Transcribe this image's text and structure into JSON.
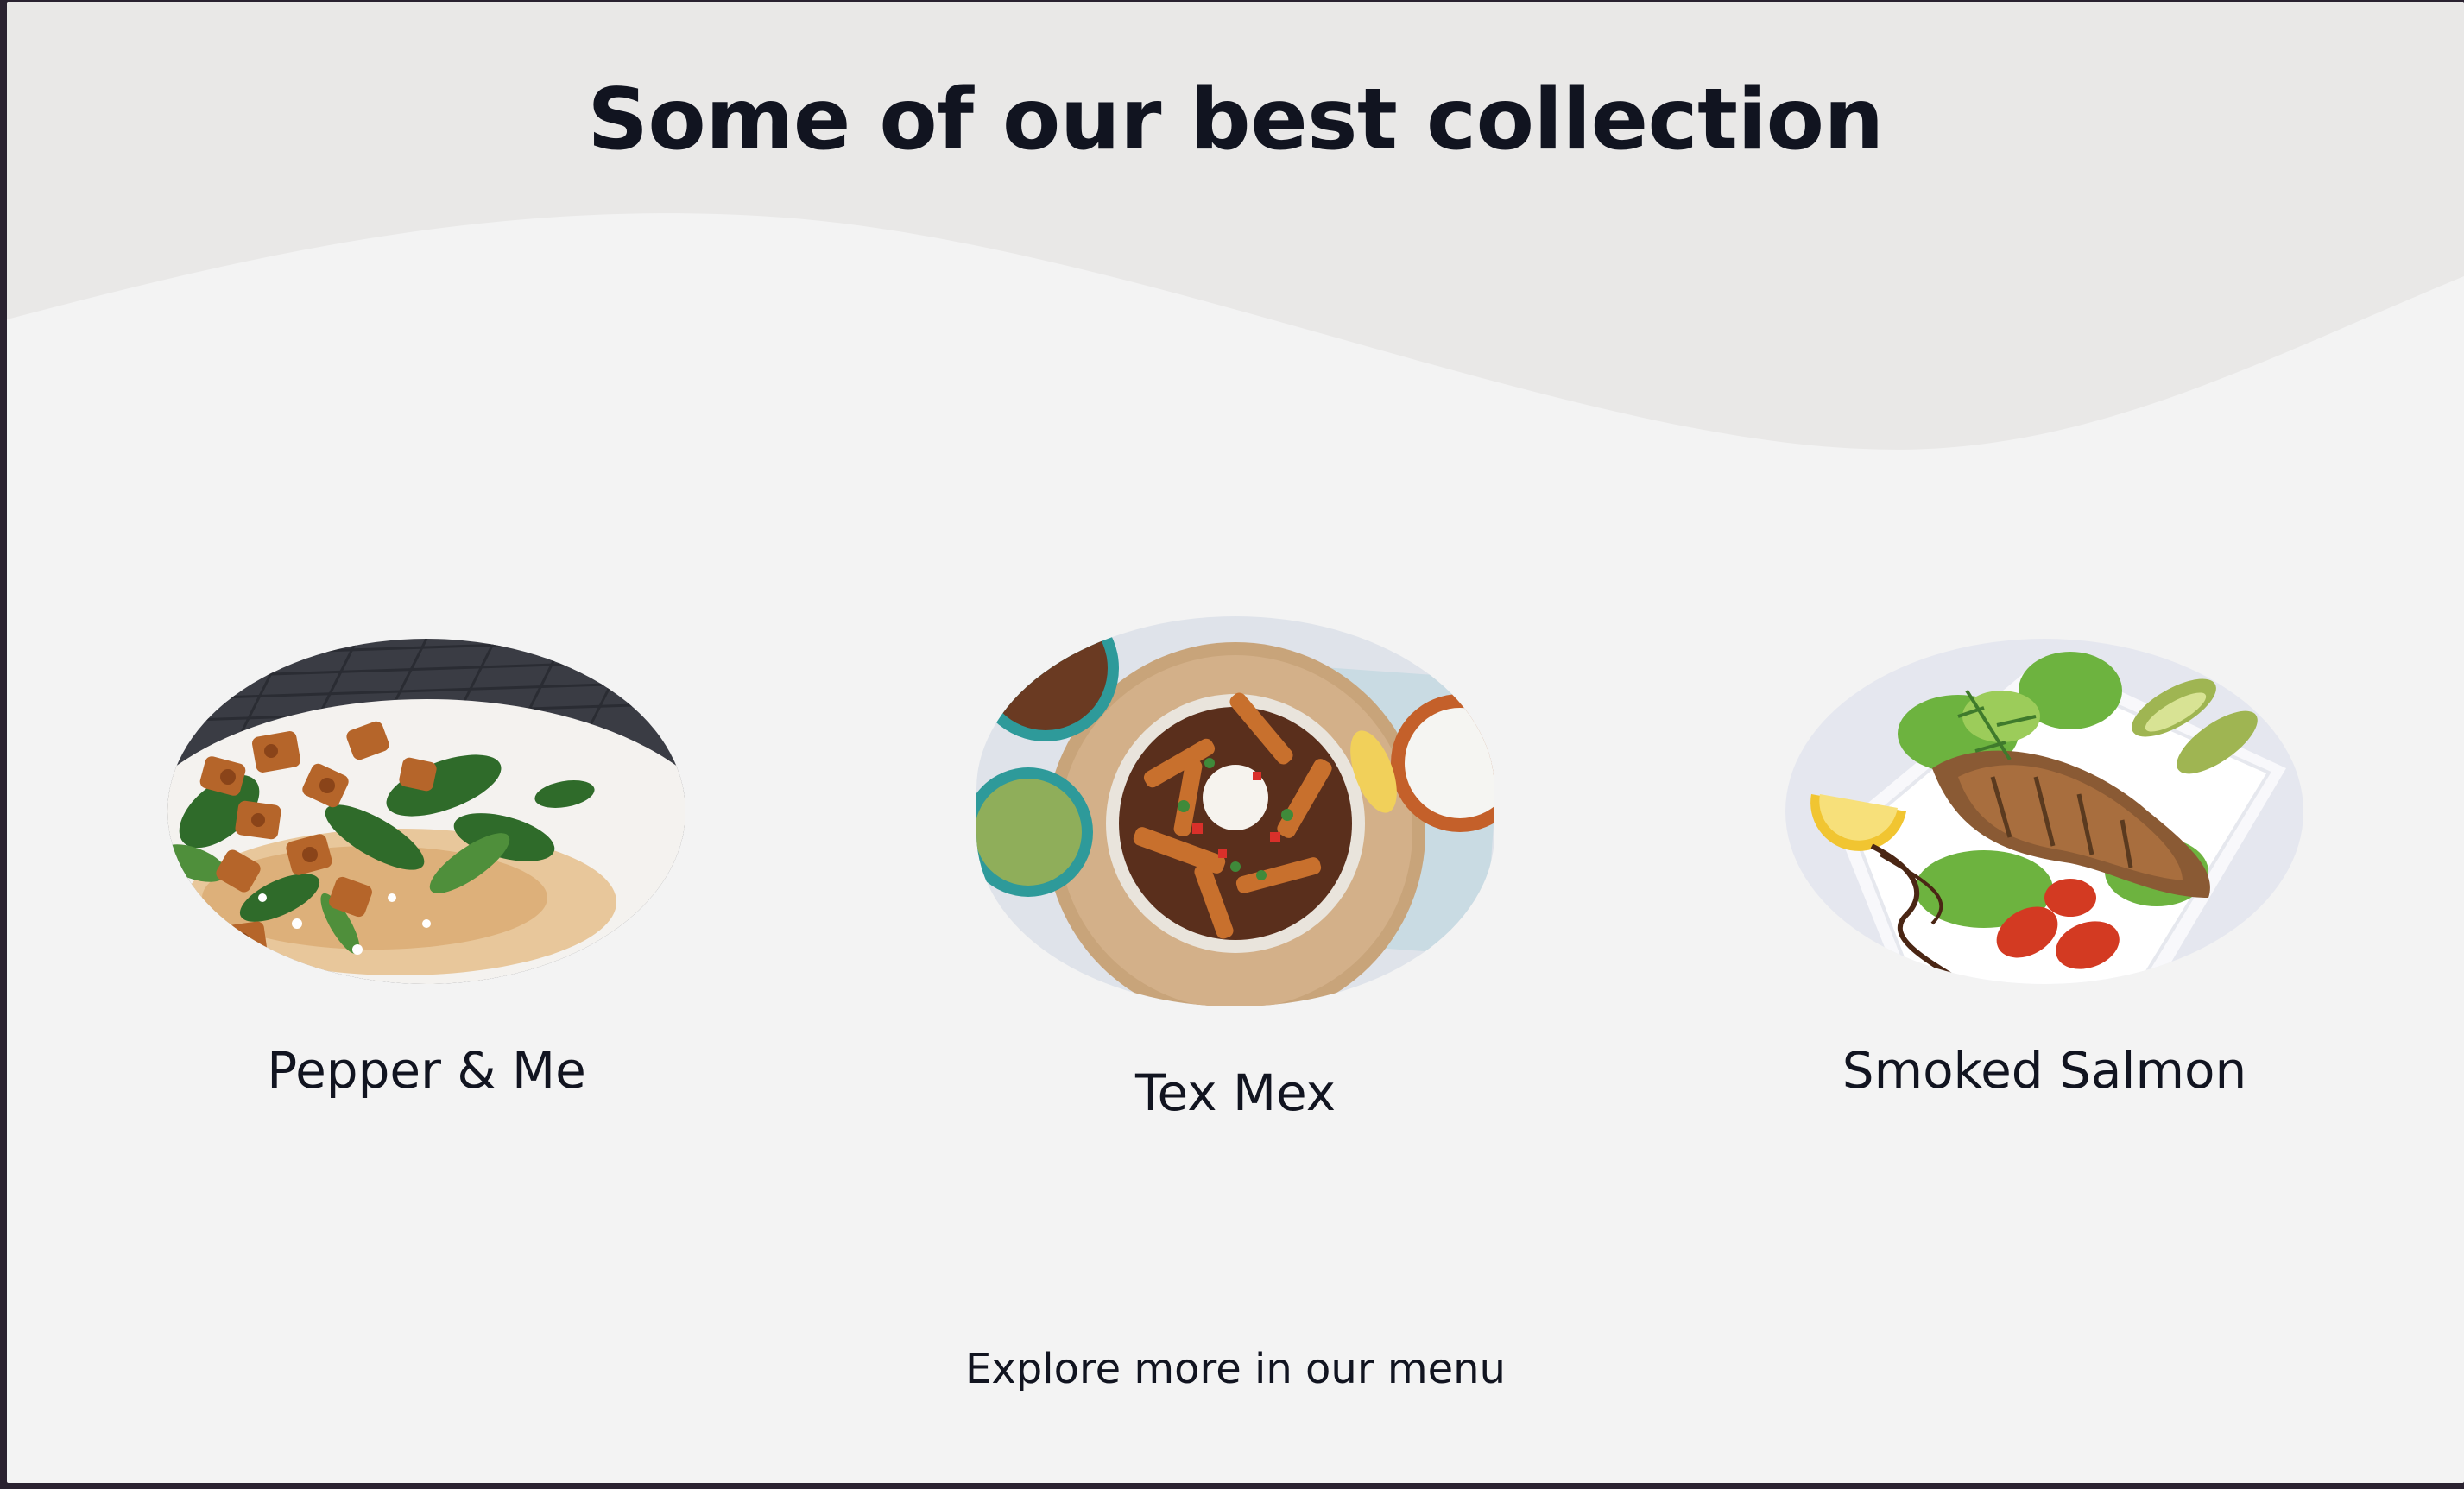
{
  "section": {
    "title": "Some of our best collection",
    "explore_link": "Explore more in our menu"
  },
  "dishes": [
    {
      "name": "Pepper & Me",
      "image_icon": "chicken-salad-photo"
    },
    {
      "name": "Tex Mex",
      "image_icon": "tex-mex-fries-photo"
    },
    {
      "name": "Smoked Salmon",
      "image_icon": "smoked-salmon-photo"
    }
  ],
  "colors": {
    "page_background": "#f3f3f3",
    "header_band": "#e9e8e7",
    "text": "#111420",
    "window_frame": "#2a2230"
  }
}
